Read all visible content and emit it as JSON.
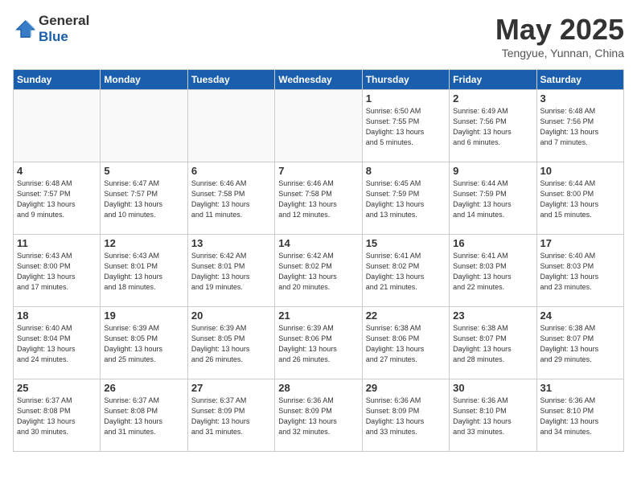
{
  "header": {
    "logo_general": "General",
    "logo_blue": "Blue",
    "title": "May 2025",
    "location": "Tengyue, Yunnan, China"
  },
  "weekdays": [
    "Sunday",
    "Monday",
    "Tuesday",
    "Wednesday",
    "Thursday",
    "Friday",
    "Saturday"
  ],
  "weeks": [
    [
      {
        "num": "",
        "info": ""
      },
      {
        "num": "",
        "info": ""
      },
      {
        "num": "",
        "info": ""
      },
      {
        "num": "",
        "info": ""
      },
      {
        "num": "1",
        "info": "Sunrise: 6:50 AM\nSunset: 7:55 PM\nDaylight: 13 hours\nand 5 minutes."
      },
      {
        "num": "2",
        "info": "Sunrise: 6:49 AM\nSunset: 7:56 PM\nDaylight: 13 hours\nand 6 minutes."
      },
      {
        "num": "3",
        "info": "Sunrise: 6:48 AM\nSunset: 7:56 PM\nDaylight: 13 hours\nand 7 minutes."
      }
    ],
    [
      {
        "num": "4",
        "info": "Sunrise: 6:48 AM\nSunset: 7:57 PM\nDaylight: 13 hours\nand 9 minutes."
      },
      {
        "num": "5",
        "info": "Sunrise: 6:47 AM\nSunset: 7:57 PM\nDaylight: 13 hours\nand 10 minutes."
      },
      {
        "num": "6",
        "info": "Sunrise: 6:46 AM\nSunset: 7:58 PM\nDaylight: 13 hours\nand 11 minutes."
      },
      {
        "num": "7",
        "info": "Sunrise: 6:46 AM\nSunset: 7:58 PM\nDaylight: 13 hours\nand 12 minutes."
      },
      {
        "num": "8",
        "info": "Sunrise: 6:45 AM\nSunset: 7:59 PM\nDaylight: 13 hours\nand 13 minutes."
      },
      {
        "num": "9",
        "info": "Sunrise: 6:44 AM\nSunset: 7:59 PM\nDaylight: 13 hours\nand 14 minutes."
      },
      {
        "num": "10",
        "info": "Sunrise: 6:44 AM\nSunset: 8:00 PM\nDaylight: 13 hours\nand 15 minutes."
      }
    ],
    [
      {
        "num": "11",
        "info": "Sunrise: 6:43 AM\nSunset: 8:00 PM\nDaylight: 13 hours\nand 17 minutes."
      },
      {
        "num": "12",
        "info": "Sunrise: 6:43 AM\nSunset: 8:01 PM\nDaylight: 13 hours\nand 18 minutes."
      },
      {
        "num": "13",
        "info": "Sunrise: 6:42 AM\nSunset: 8:01 PM\nDaylight: 13 hours\nand 19 minutes."
      },
      {
        "num": "14",
        "info": "Sunrise: 6:42 AM\nSunset: 8:02 PM\nDaylight: 13 hours\nand 20 minutes."
      },
      {
        "num": "15",
        "info": "Sunrise: 6:41 AM\nSunset: 8:02 PM\nDaylight: 13 hours\nand 21 minutes."
      },
      {
        "num": "16",
        "info": "Sunrise: 6:41 AM\nSunset: 8:03 PM\nDaylight: 13 hours\nand 22 minutes."
      },
      {
        "num": "17",
        "info": "Sunrise: 6:40 AM\nSunset: 8:03 PM\nDaylight: 13 hours\nand 23 minutes."
      }
    ],
    [
      {
        "num": "18",
        "info": "Sunrise: 6:40 AM\nSunset: 8:04 PM\nDaylight: 13 hours\nand 24 minutes."
      },
      {
        "num": "19",
        "info": "Sunrise: 6:39 AM\nSunset: 8:05 PM\nDaylight: 13 hours\nand 25 minutes."
      },
      {
        "num": "20",
        "info": "Sunrise: 6:39 AM\nSunset: 8:05 PM\nDaylight: 13 hours\nand 26 minutes."
      },
      {
        "num": "21",
        "info": "Sunrise: 6:39 AM\nSunset: 8:06 PM\nDaylight: 13 hours\nand 26 minutes."
      },
      {
        "num": "22",
        "info": "Sunrise: 6:38 AM\nSunset: 8:06 PM\nDaylight: 13 hours\nand 27 minutes."
      },
      {
        "num": "23",
        "info": "Sunrise: 6:38 AM\nSunset: 8:07 PM\nDaylight: 13 hours\nand 28 minutes."
      },
      {
        "num": "24",
        "info": "Sunrise: 6:38 AM\nSunset: 8:07 PM\nDaylight: 13 hours\nand 29 minutes."
      }
    ],
    [
      {
        "num": "25",
        "info": "Sunrise: 6:37 AM\nSunset: 8:08 PM\nDaylight: 13 hours\nand 30 minutes."
      },
      {
        "num": "26",
        "info": "Sunrise: 6:37 AM\nSunset: 8:08 PM\nDaylight: 13 hours\nand 31 minutes."
      },
      {
        "num": "27",
        "info": "Sunrise: 6:37 AM\nSunset: 8:09 PM\nDaylight: 13 hours\nand 31 minutes."
      },
      {
        "num": "28",
        "info": "Sunrise: 6:36 AM\nSunset: 8:09 PM\nDaylight: 13 hours\nand 32 minutes."
      },
      {
        "num": "29",
        "info": "Sunrise: 6:36 AM\nSunset: 8:09 PM\nDaylight: 13 hours\nand 33 minutes."
      },
      {
        "num": "30",
        "info": "Sunrise: 6:36 AM\nSunset: 8:10 PM\nDaylight: 13 hours\nand 33 minutes."
      },
      {
        "num": "31",
        "info": "Sunrise: 6:36 AM\nSunset: 8:10 PM\nDaylight: 13 hours\nand 34 minutes."
      }
    ]
  ]
}
